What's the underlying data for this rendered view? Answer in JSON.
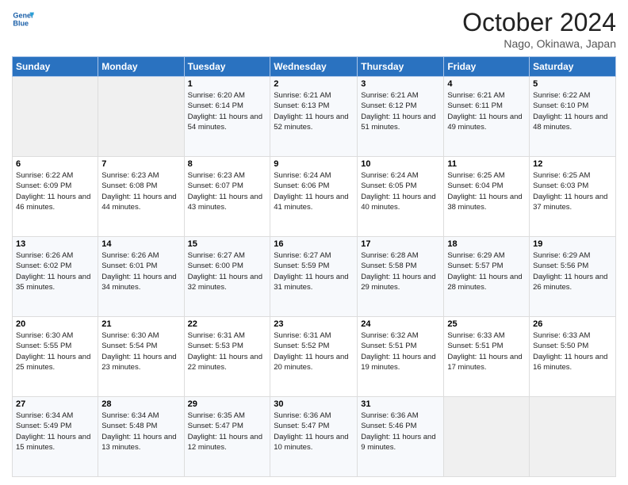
{
  "header": {
    "logo_line1": "General",
    "logo_line2": "Blue",
    "month": "October 2024",
    "location": "Nago, Okinawa, Japan"
  },
  "days_of_week": [
    "Sunday",
    "Monday",
    "Tuesday",
    "Wednesday",
    "Thursday",
    "Friday",
    "Saturday"
  ],
  "weeks": [
    [
      {
        "day": "",
        "info": ""
      },
      {
        "day": "",
        "info": ""
      },
      {
        "day": "1",
        "info": "Sunrise: 6:20 AM\nSunset: 6:14 PM\nDaylight: 11 hours and 54 minutes."
      },
      {
        "day": "2",
        "info": "Sunrise: 6:21 AM\nSunset: 6:13 PM\nDaylight: 11 hours and 52 minutes."
      },
      {
        "day": "3",
        "info": "Sunrise: 6:21 AM\nSunset: 6:12 PM\nDaylight: 11 hours and 51 minutes."
      },
      {
        "day": "4",
        "info": "Sunrise: 6:21 AM\nSunset: 6:11 PM\nDaylight: 11 hours and 49 minutes."
      },
      {
        "day": "5",
        "info": "Sunrise: 6:22 AM\nSunset: 6:10 PM\nDaylight: 11 hours and 48 minutes."
      }
    ],
    [
      {
        "day": "6",
        "info": "Sunrise: 6:22 AM\nSunset: 6:09 PM\nDaylight: 11 hours and 46 minutes."
      },
      {
        "day": "7",
        "info": "Sunrise: 6:23 AM\nSunset: 6:08 PM\nDaylight: 11 hours and 44 minutes."
      },
      {
        "day": "8",
        "info": "Sunrise: 6:23 AM\nSunset: 6:07 PM\nDaylight: 11 hours and 43 minutes."
      },
      {
        "day": "9",
        "info": "Sunrise: 6:24 AM\nSunset: 6:06 PM\nDaylight: 11 hours and 41 minutes."
      },
      {
        "day": "10",
        "info": "Sunrise: 6:24 AM\nSunset: 6:05 PM\nDaylight: 11 hours and 40 minutes."
      },
      {
        "day": "11",
        "info": "Sunrise: 6:25 AM\nSunset: 6:04 PM\nDaylight: 11 hours and 38 minutes."
      },
      {
        "day": "12",
        "info": "Sunrise: 6:25 AM\nSunset: 6:03 PM\nDaylight: 11 hours and 37 minutes."
      }
    ],
    [
      {
        "day": "13",
        "info": "Sunrise: 6:26 AM\nSunset: 6:02 PM\nDaylight: 11 hours and 35 minutes."
      },
      {
        "day": "14",
        "info": "Sunrise: 6:26 AM\nSunset: 6:01 PM\nDaylight: 11 hours and 34 minutes."
      },
      {
        "day": "15",
        "info": "Sunrise: 6:27 AM\nSunset: 6:00 PM\nDaylight: 11 hours and 32 minutes."
      },
      {
        "day": "16",
        "info": "Sunrise: 6:27 AM\nSunset: 5:59 PM\nDaylight: 11 hours and 31 minutes."
      },
      {
        "day": "17",
        "info": "Sunrise: 6:28 AM\nSunset: 5:58 PM\nDaylight: 11 hours and 29 minutes."
      },
      {
        "day": "18",
        "info": "Sunrise: 6:29 AM\nSunset: 5:57 PM\nDaylight: 11 hours and 28 minutes."
      },
      {
        "day": "19",
        "info": "Sunrise: 6:29 AM\nSunset: 5:56 PM\nDaylight: 11 hours and 26 minutes."
      }
    ],
    [
      {
        "day": "20",
        "info": "Sunrise: 6:30 AM\nSunset: 5:55 PM\nDaylight: 11 hours and 25 minutes."
      },
      {
        "day": "21",
        "info": "Sunrise: 6:30 AM\nSunset: 5:54 PM\nDaylight: 11 hours and 23 minutes."
      },
      {
        "day": "22",
        "info": "Sunrise: 6:31 AM\nSunset: 5:53 PM\nDaylight: 11 hours and 22 minutes."
      },
      {
        "day": "23",
        "info": "Sunrise: 6:31 AM\nSunset: 5:52 PM\nDaylight: 11 hours and 20 minutes."
      },
      {
        "day": "24",
        "info": "Sunrise: 6:32 AM\nSunset: 5:51 PM\nDaylight: 11 hours and 19 minutes."
      },
      {
        "day": "25",
        "info": "Sunrise: 6:33 AM\nSunset: 5:51 PM\nDaylight: 11 hours and 17 minutes."
      },
      {
        "day": "26",
        "info": "Sunrise: 6:33 AM\nSunset: 5:50 PM\nDaylight: 11 hours and 16 minutes."
      }
    ],
    [
      {
        "day": "27",
        "info": "Sunrise: 6:34 AM\nSunset: 5:49 PM\nDaylight: 11 hours and 15 minutes."
      },
      {
        "day": "28",
        "info": "Sunrise: 6:34 AM\nSunset: 5:48 PM\nDaylight: 11 hours and 13 minutes."
      },
      {
        "day": "29",
        "info": "Sunrise: 6:35 AM\nSunset: 5:47 PM\nDaylight: 11 hours and 12 minutes."
      },
      {
        "day": "30",
        "info": "Sunrise: 6:36 AM\nSunset: 5:47 PM\nDaylight: 11 hours and 10 minutes."
      },
      {
        "day": "31",
        "info": "Sunrise: 6:36 AM\nSunset: 5:46 PM\nDaylight: 11 hours and 9 minutes."
      },
      {
        "day": "",
        "info": ""
      },
      {
        "day": "",
        "info": ""
      }
    ]
  ]
}
